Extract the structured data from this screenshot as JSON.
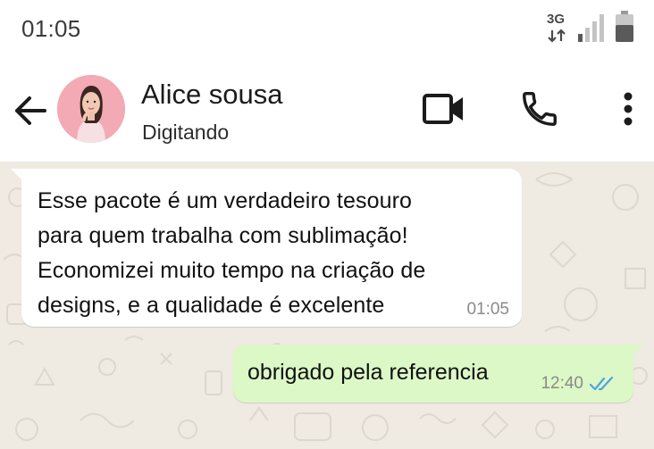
{
  "status_bar": {
    "time": "01:05",
    "network_type": "3G",
    "icons": [
      "data-transfer-arrows-icon",
      "signal-strength-icon",
      "battery-icon"
    ],
    "signal_level": 0.25,
    "battery_level": 0.6
  },
  "header": {
    "back_icon": "arrow-left-icon",
    "contact_name": "Alice sousa",
    "contact_status": "Digitando",
    "actions": [
      "video-call-icon",
      "phone-icon",
      "more-vertical-icon"
    ]
  },
  "messages": [
    {
      "direction": "incoming",
      "text": "Esse pacote é um verdadeiro tesouro\npara quem trabalha com sublimação!\nEconomizei muito tempo na criação de\ndesigns, e a qualidade é excelente",
      "time": "01:05"
    },
    {
      "direction": "outgoing",
      "text": "obrigado pela referencia",
      "time": "12:40",
      "status_icon": "double-check-read-icon"
    }
  ],
  "colors": {
    "chat_background": "#efeae2",
    "incoming_bubble": "#ffffff",
    "outgoing_bubble": "#dcf8c6",
    "read_receipt": "#4fa3e0",
    "icon_dark": "#1b1b1b"
  }
}
